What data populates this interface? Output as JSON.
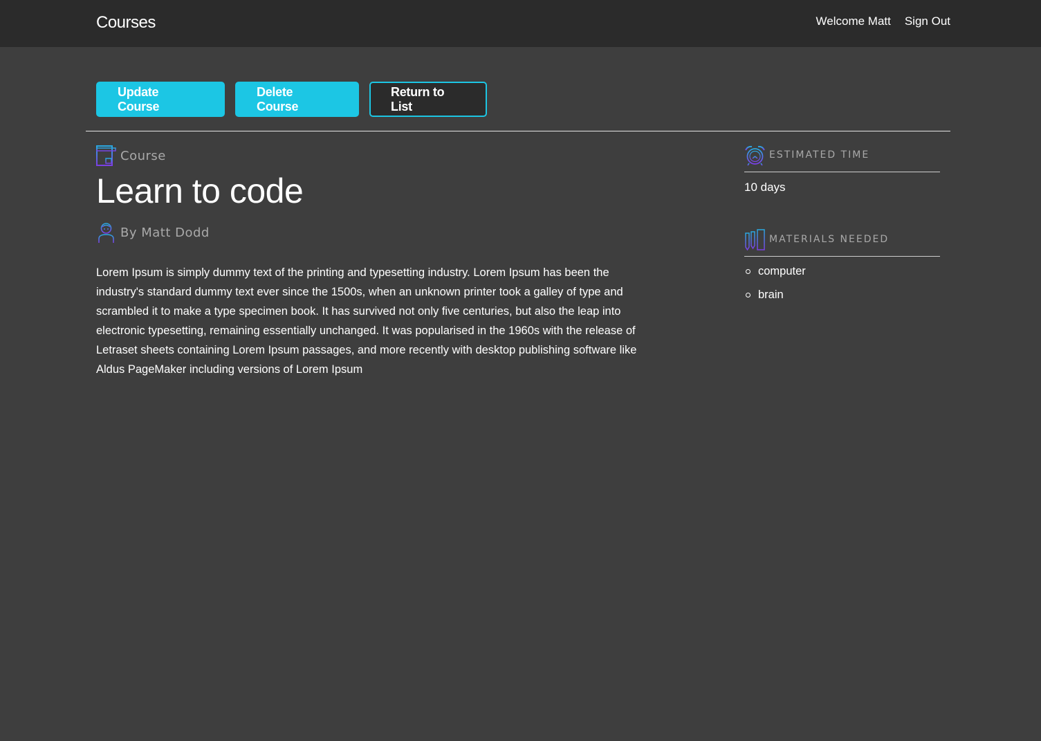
{
  "header": {
    "brand": "Courses",
    "welcome": "Welcome Matt",
    "sign_out": "Sign Out"
  },
  "actions": {
    "update": "Update Course",
    "delete": "Delete Course",
    "return": "Return to List"
  },
  "course": {
    "label": "Course",
    "title": "Learn to code",
    "author": "By Matt Dodd",
    "description": "Lorem Ipsum is simply dummy text of the printing and typesetting industry. Lorem Ipsum has been the industry's standard dummy text ever since the 1500s, when an unknown printer took a galley of type and scrambled it to make a type specimen book. It has survived not only five centuries, but also the leap into electronic typesetting, remaining essentially unchanged. It was popularised in the 1960s with the release of Letraset sheets containing Lorem Ipsum passages, and more recently with desktop publishing software like Aldus PageMaker including versions of Lorem Ipsum"
  },
  "sidebar": {
    "estimated_time": {
      "title": "ESTIMATED TIME",
      "value": "10 days",
      "icon": "alarm-clock-icon"
    },
    "materials": {
      "title": "MATERIALS NEEDED",
      "icon": "pencils-ruler-icon",
      "items": [
        "computer",
        "brain"
      ]
    }
  },
  "icons": {
    "course_label": "book-icon",
    "author": "person-icon"
  },
  "colors": {
    "accent": "#1cc6e4",
    "header_bg": "#2b2b2b",
    "page_bg": "#3e3e3e",
    "icon_gradient_start": "#2aa9e0",
    "icon_gradient_end": "#7b3fe4"
  }
}
